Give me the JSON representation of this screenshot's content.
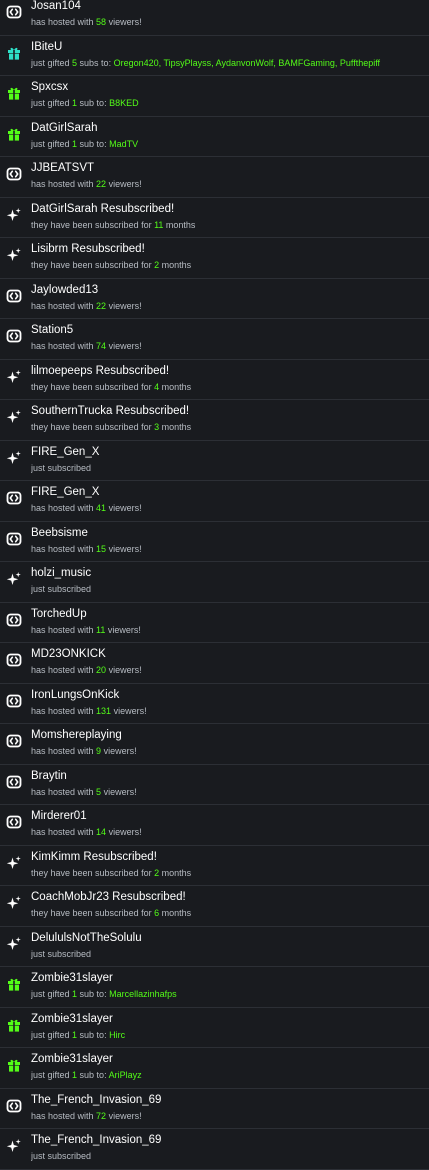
{
  "colors": {
    "background": "#191b1f",
    "divider": "#2c2f35",
    "highlight": "#53fc18",
    "subtext": "#b7bcc3",
    "gift_green": "#53fc18",
    "gift_teal": "#2ee0c8"
  },
  "events": [
    {
      "type": "host",
      "icon": "host-icon",
      "title": "Josan104",
      "sub": [
        {
          "t": "has hosted with "
        },
        {
          "t": "58",
          "hl": true
        },
        {
          "t": " viewers!"
        }
      ]
    },
    {
      "type": "gift",
      "icon": "gift-icon",
      "icon_color": "#2ee0c8",
      "title": "IBiteU",
      "sub": [
        {
          "t": "just gifted "
        },
        {
          "t": "5",
          "hl": true
        },
        {
          "t": " subs to: "
        },
        {
          "t": "Oregon420, TipsyPlayss, AydanvonWolf, BAMFGaming, Puffthepiff",
          "hl": true
        }
      ]
    },
    {
      "type": "gift",
      "icon": "gift-icon",
      "icon_color": "#53fc18",
      "title": "Spxcsx",
      "sub": [
        {
          "t": "just gifted "
        },
        {
          "t": "1",
          "hl": true
        },
        {
          "t": " sub to: "
        },
        {
          "t": "B8KED",
          "hl": true
        }
      ]
    },
    {
      "type": "gift",
      "icon": "gift-icon",
      "icon_color": "#53fc18",
      "title": "DatGirlSarah",
      "sub": [
        {
          "t": "just gifted "
        },
        {
          "t": "1",
          "hl": true
        },
        {
          "t": " sub to: "
        },
        {
          "t": "MadTV",
          "hl": true
        }
      ]
    },
    {
      "type": "host",
      "icon": "host-icon",
      "title": "JJBEATSVT",
      "sub": [
        {
          "t": "has hosted with "
        },
        {
          "t": "22",
          "hl": true
        },
        {
          "t": " viewers!"
        }
      ]
    },
    {
      "type": "resub",
      "icon": "sparkle-icon",
      "title": "DatGirlSarah Resubscribed!",
      "sub": [
        {
          "t": "they have been subscribed for "
        },
        {
          "t": "11",
          "hl": true
        },
        {
          "t": " months"
        }
      ]
    },
    {
      "type": "resub",
      "icon": "sparkle-icon",
      "title": "Lisibrm Resubscribed!",
      "sub": [
        {
          "t": "they have been subscribed for "
        },
        {
          "t": "2",
          "hl": true
        },
        {
          "t": " months"
        }
      ]
    },
    {
      "type": "host",
      "icon": "host-icon",
      "title": "Jaylowded13",
      "sub": [
        {
          "t": "has hosted with "
        },
        {
          "t": "22",
          "hl": true
        },
        {
          "t": " viewers!"
        }
      ]
    },
    {
      "type": "host",
      "icon": "host-icon",
      "title": "Station5",
      "sub": [
        {
          "t": "has hosted with "
        },
        {
          "t": "74",
          "hl": true
        },
        {
          "t": " viewers!"
        }
      ]
    },
    {
      "type": "resub",
      "icon": "sparkle-icon",
      "title": "lilmoepeeps Resubscribed!",
      "sub": [
        {
          "t": "they have been subscribed for "
        },
        {
          "t": "4",
          "hl": true
        },
        {
          "t": " months"
        }
      ]
    },
    {
      "type": "resub",
      "icon": "sparkle-icon",
      "title": "SouthernTrucka Resubscribed!",
      "sub": [
        {
          "t": "they have been subscribed for "
        },
        {
          "t": "3",
          "hl": true
        },
        {
          "t": " months"
        }
      ]
    },
    {
      "type": "sub",
      "icon": "sparkle-icon",
      "title": "FIRE_Gen_X",
      "sub": [
        {
          "t": "just subscribed"
        }
      ]
    },
    {
      "type": "host",
      "icon": "host-icon",
      "title": "FIRE_Gen_X",
      "sub": [
        {
          "t": "has hosted with "
        },
        {
          "t": "41",
          "hl": true
        },
        {
          "t": " viewers!"
        }
      ]
    },
    {
      "type": "host",
      "icon": "host-icon",
      "title": "Beebsisme",
      "sub": [
        {
          "t": "has hosted with "
        },
        {
          "t": "15",
          "hl": true
        },
        {
          "t": " viewers!"
        }
      ]
    },
    {
      "type": "sub",
      "icon": "sparkle-icon",
      "title": "holzi_music",
      "sub": [
        {
          "t": "just subscribed"
        }
      ]
    },
    {
      "type": "host",
      "icon": "host-icon",
      "title": "TorchedUp",
      "sub": [
        {
          "t": "has hosted with "
        },
        {
          "t": "11",
          "hl": true
        },
        {
          "t": " viewers!"
        }
      ]
    },
    {
      "type": "host",
      "icon": "host-icon",
      "title": "MD23ONKICK",
      "sub": [
        {
          "t": "has hosted with "
        },
        {
          "t": "20",
          "hl": true
        },
        {
          "t": " viewers!"
        }
      ]
    },
    {
      "type": "host",
      "icon": "host-icon",
      "title": "IronLungsOnKick",
      "sub": [
        {
          "t": "has hosted with "
        },
        {
          "t": "131",
          "hl": true
        },
        {
          "t": " viewers!"
        }
      ]
    },
    {
      "type": "host",
      "icon": "host-icon",
      "title": "Momshereplaying",
      "sub": [
        {
          "t": "has hosted with "
        },
        {
          "t": "9",
          "hl": true
        },
        {
          "t": " viewers!"
        }
      ]
    },
    {
      "type": "host",
      "icon": "host-icon",
      "title": "Braytin",
      "sub": [
        {
          "t": "has hosted with "
        },
        {
          "t": "5",
          "hl": true
        },
        {
          "t": " viewers!"
        }
      ]
    },
    {
      "type": "host",
      "icon": "host-icon",
      "title": "Mirderer01",
      "sub": [
        {
          "t": "has hosted with "
        },
        {
          "t": "14",
          "hl": true
        },
        {
          "t": " viewers!"
        }
      ]
    },
    {
      "type": "resub",
      "icon": "sparkle-icon",
      "title": "KimKimm Resubscribed!",
      "sub": [
        {
          "t": "they have been subscribed for "
        },
        {
          "t": "2",
          "hl": true
        },
        {
          "t": " months"
        }
      ]
    },
    {
      "type": "resub",
      "icon": "sparkle-icon",
      "title": "CoachMobJr23 Resubscribed!",
      "sub": [
        {
          "t": "they have been subscribed for "
        },
        {
          "t": "6",
          "hl": true
        },
        {
          "t": " months"
        }
      ]
    },
    {
      "type": "sub",
      "icon": "sparkle-icon",
      "title": "DelululsNotTheSolulu",
      "sub": [
        {
          "t": "just subscribed"
        }
      ]
    },
    {
      "type": "gift",
      "icon": "gift-icon",
      "icon_color": "#53fc18",
      "title": "Zombie31slayer",
      "sub": [
        {
          "t": "just gifted "
        },
        {
          "t": "1",
          "hl": true
        },
        {
          "t": " sub to: "
        },
        {
          "t": "Marcellazinhafps",
          "hl": true
        }
      ]
    },
    {
      "type": "gift",
      "icon": "gift-icon",
      "icon_color": "#53fc18",
      "title": "Zombie31slayer",
      "sub": [
        {
          "t": "just gifted "
        },
        {
          "t": "1",
          "hl": true
        },
        {
          "t": " sub to: "
        },
        {
          "t": "Hirc",
          "hl": true
        }
      ]
    },
    {
      "type": "gift",
      "icon": "gift-icon",
      "icon_color": "#53fc18",
      "title": "Zombie31slayer",
      "sub": [
        {
          "t": "just gifted "
        },
        {
          "t": "1",
          "hl": true
        },
        {
          "t": " sub to: "
        },
        {
          "t": "AriPlayz",
          "hl": true
        }
      ]
    },
    {
      "type": "host",
      "icon": "host-icon",
      "title": "The_French_Invasion_69",
      "sub": [
        {
          "t": "has hosted with "
        },
        {
          "t": "72",
          "hl": true
        },
        {
          "t": " viewers!"
        }
      ]
    },
    {
      "type": "sub",
      "icon": "sparkle-icon",
      "title": "The_French_Invasion_69",
      "sub": [
        {
          "t": "just subscribed"
        }
      ]
    }
  ]
}
